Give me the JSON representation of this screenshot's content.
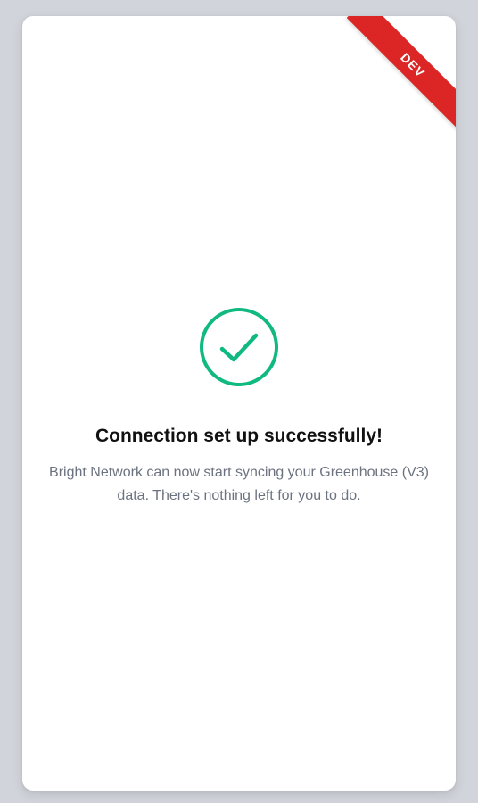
{
  "ribbon": {
    "label": "DEV",
    "color": "#dc2626"
  },
  "status": {
    "icon": "check-circle-icon",
    "icon_color": "#10b981",
    "title": "Connection set up successfully!",
    "message": "Bright Network can now start syncing your Greenhouse (V3) data. There's nothing left for you to do."
  }
}
